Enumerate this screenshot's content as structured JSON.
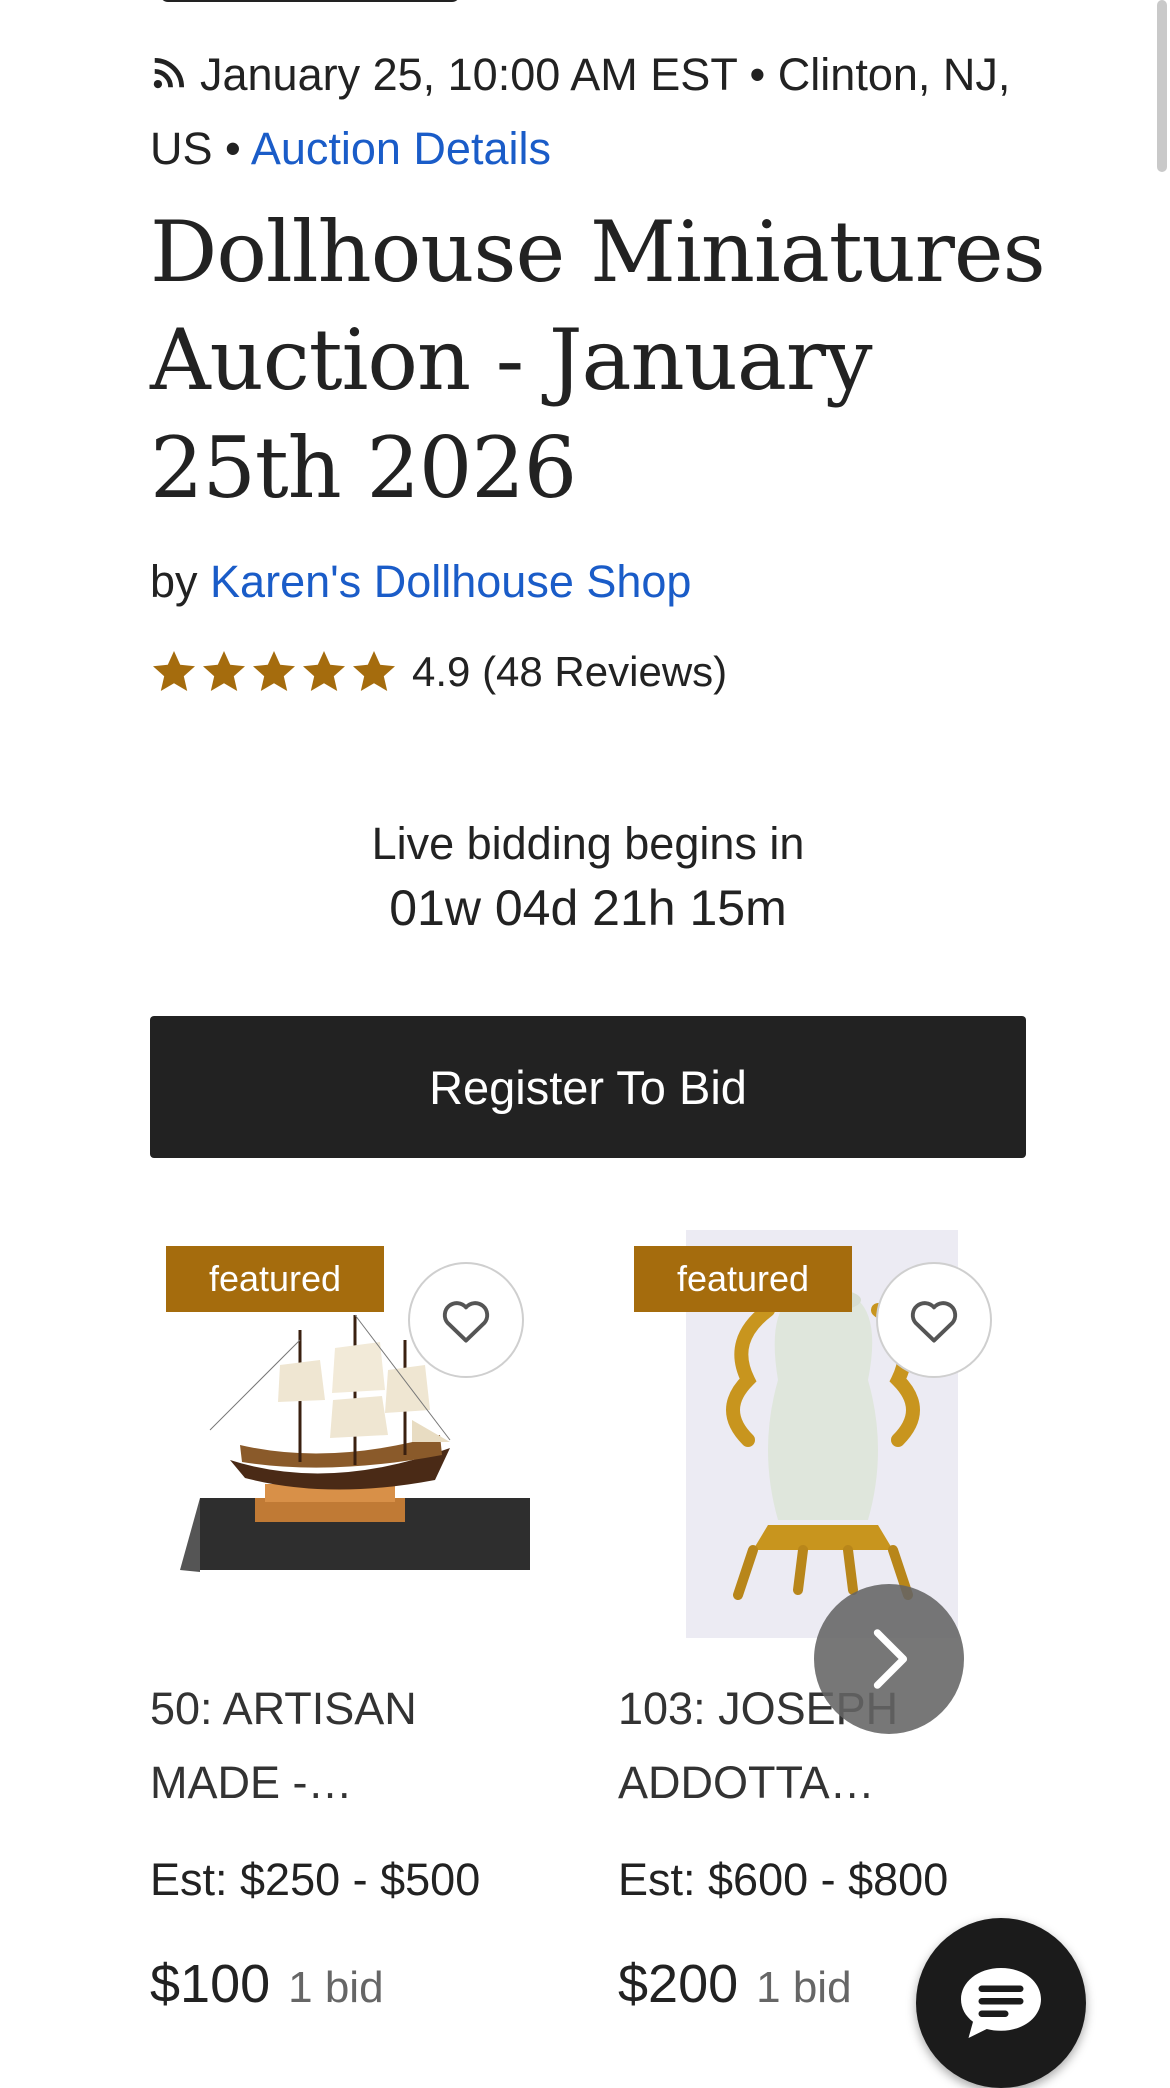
{
  "header": {
    "date": "January 25, 10:00 AM EST",
    "location": "Clinton, NJ, US",
    "details_link": "Auction Details",
    "separator": "•"
  },
  "auction": {
    "title": "Dollhouse Miniatures Auction - January 25th 2026",
    "by_prefix": "by",
    "seller": "Karen's Dollhouse Shop",
    "rating": "4.9",
    "rating_value": 4.9,
    "reviews": "(48 Reviews)"
  },
  "countdown": {
    "label": "Live bidding begins in",
    "time": "01w 04d 21h 15m"
  },
  "register_button": "Register To Bid",
  "lots": [
    {
      "badge": "featured",
      "title": "50: ARTISAN MADE -…",
      "estimate": "Est: $250 - $500",
      "price": "$100",
      "bids": "1 bid"
    },
    {
      "badge": "featured",
      "title": "103: JOSEPH ADDOTTA…",
      "estimate": "Est: $600 - $800",
      "price": "$200",
      "bids": "1 bid"
    }
  ],
  "colors": {
    "link": "#1a5cc8",
    "badge": "#a56c0d",
    "star": "#a56c0d",
    "button": "#222222"
  },
  "icons": [
    "rss-icon",
    "star-icon",
    "heart-icon",
    "chevron-right-icon",
    "chat-icon"
  ]
}
